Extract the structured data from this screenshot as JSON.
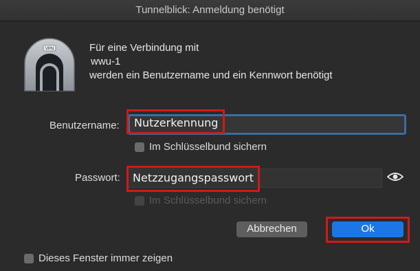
{
  "window": {
    "title": "Tunnelblick: Anmeldung benötigt"
  },
  "icon": {
    "name": "vpn-tunnel-icon",
    "badge": "VPN"
  },
  "message": {
    "line1": "Für eine Verbindung mit",
    "line2": "wwu-1",
    "line3": "werden ein Benutzername und ein Kennwort benötigt"
  },
  "username": {
    "label": "Benutzername:",
    "value": "Nutzerkennung",
    "save_checkbox_label": "Im Schlüsselbund sichern"
  },
  "password": {
    "label": "Passwort:",
    "value": "Netzzugangspasswort",
    "save_checkbox_label": "Im Schlüsselbund sichern"
  },
  "buttons": {
    "cancel": "Abbrechen",
    "ok": "Ok"
  },
  "footer": {
    "always_show_label": "Dieses Fenster immer zeigen"
  },
  "colors": {
    "accent": "#1d76e6",
    "highlight": "#d01a1a",
    "focus_ring": "#3a6ea0"
  }
}
